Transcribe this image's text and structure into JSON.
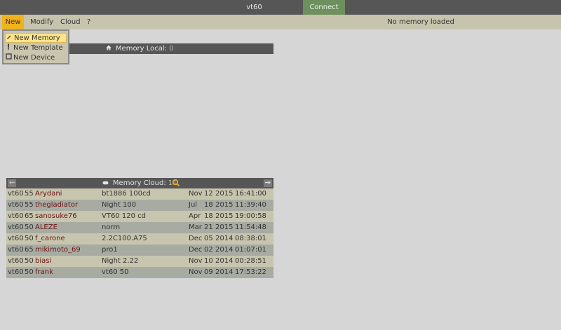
{
  "titlebar": {
    "title": "vt60",
    "connect_label": "Connect"
  },
  "menubar": {
    "items": [
      {
        "label": "New"
      },
      {
        "label": "Modify"
      },
      {
        "label": "Cloud"
      },
      {
        "label": "?"
      }
    ],
    "status": "No memory loaded"
  },
  "new_menu": {
    "items": [
      {
        "label": "New Memory",
        "icon": "pencil-icon"
      },
      {
        "label": "New Template",
        "icon": "exclamation-icon"
      },
      {
        "label": "New Device",
        "icon": "device-square-icon"
      }
    ]
  },
  "memory_local": {
    "label": "Memory Local:",
    "count": "0",
    "icon": "home-icon"
  },
  "memory_cloud": {
    "label": "Memory Cloud:",
    "count": "11",
    "icon": "cloud-icon",
    "search_icon": "search-icon",
    "prev_icon": "arrow-left-icon",
    "next_icon": "arrow-right-icon",
    "rows": [
      {
        "model": "vt60",
        "size": "55",
        "user": "Arydani",
        "name": "bt1886 100cd",
        "month": "Nov",
        "day": "12",
        "year": "2015",
        "time": "16:41:00"
      },
      {
        "model": "vt60",
        "size": "55",
        "user": "thegladiator",
        "name": "Night 100",
        "month": "Jul",
        "day": "18",
        "year": "2015",
        "time": "11:39:40"
      },
      {
        "model": "vt60",
        "size": "65",
        "user": "sanosuke76",
        "name": "VT60 120 cd",
        "month": "Apr",
        "day": "18",
        "year": "2015",
        "time": "19:00:58"
      },
      {
        "model": "vt60",
        "size": "50",
        "user": "ALEZE",
        "name": "norm",
        "month": "Mar",
        "day": "21",
        "year": "2015",
        "time": "11:54:48"
      },
      {
        "model": "vt60",
        "size": "50",
        "user": "f_carone",
        "name": "2.2C100.A75",
        "month": "Dec",
        "day": "05",
        "year": "2014",
        "time": "08:38:01"
      },
      {
        "model": "vt60",
        "size": "65",
        "user": "mikimoto_69",
        "name": "pro1",
        "month": "Dec",
        "day": "02",
        "year": "2014",
        "time": "01:07:01"
      },
      {
        "model": "vt60",
        "size": "50",
        "user": "biasi",
        "name": "Night 2.22",
        "month": "Nov",
        "day": "10",
        "year": "2014",
        "time": "00:28:51"
      },
      {
        "model": "vt60",
        "size": "50",
        "user": "frank",
        "name": "vt60 50",
        "month": "Nov",
        "day": "09",
        "year": "2014",
        "time": "17:53:22"
      }
    ]
  },
  "colors": {
    "background": "#d6d6d6",
    "header": "#565656",
    "menubar": "#c7c4ae",
    "accent": "#f0b31c",
    "connect": "#6e8f5e",
    "username": "#6e1414",
    "row_odd": "#c8c5ae",
    "row_even": "#a7aba2"
  }
}
